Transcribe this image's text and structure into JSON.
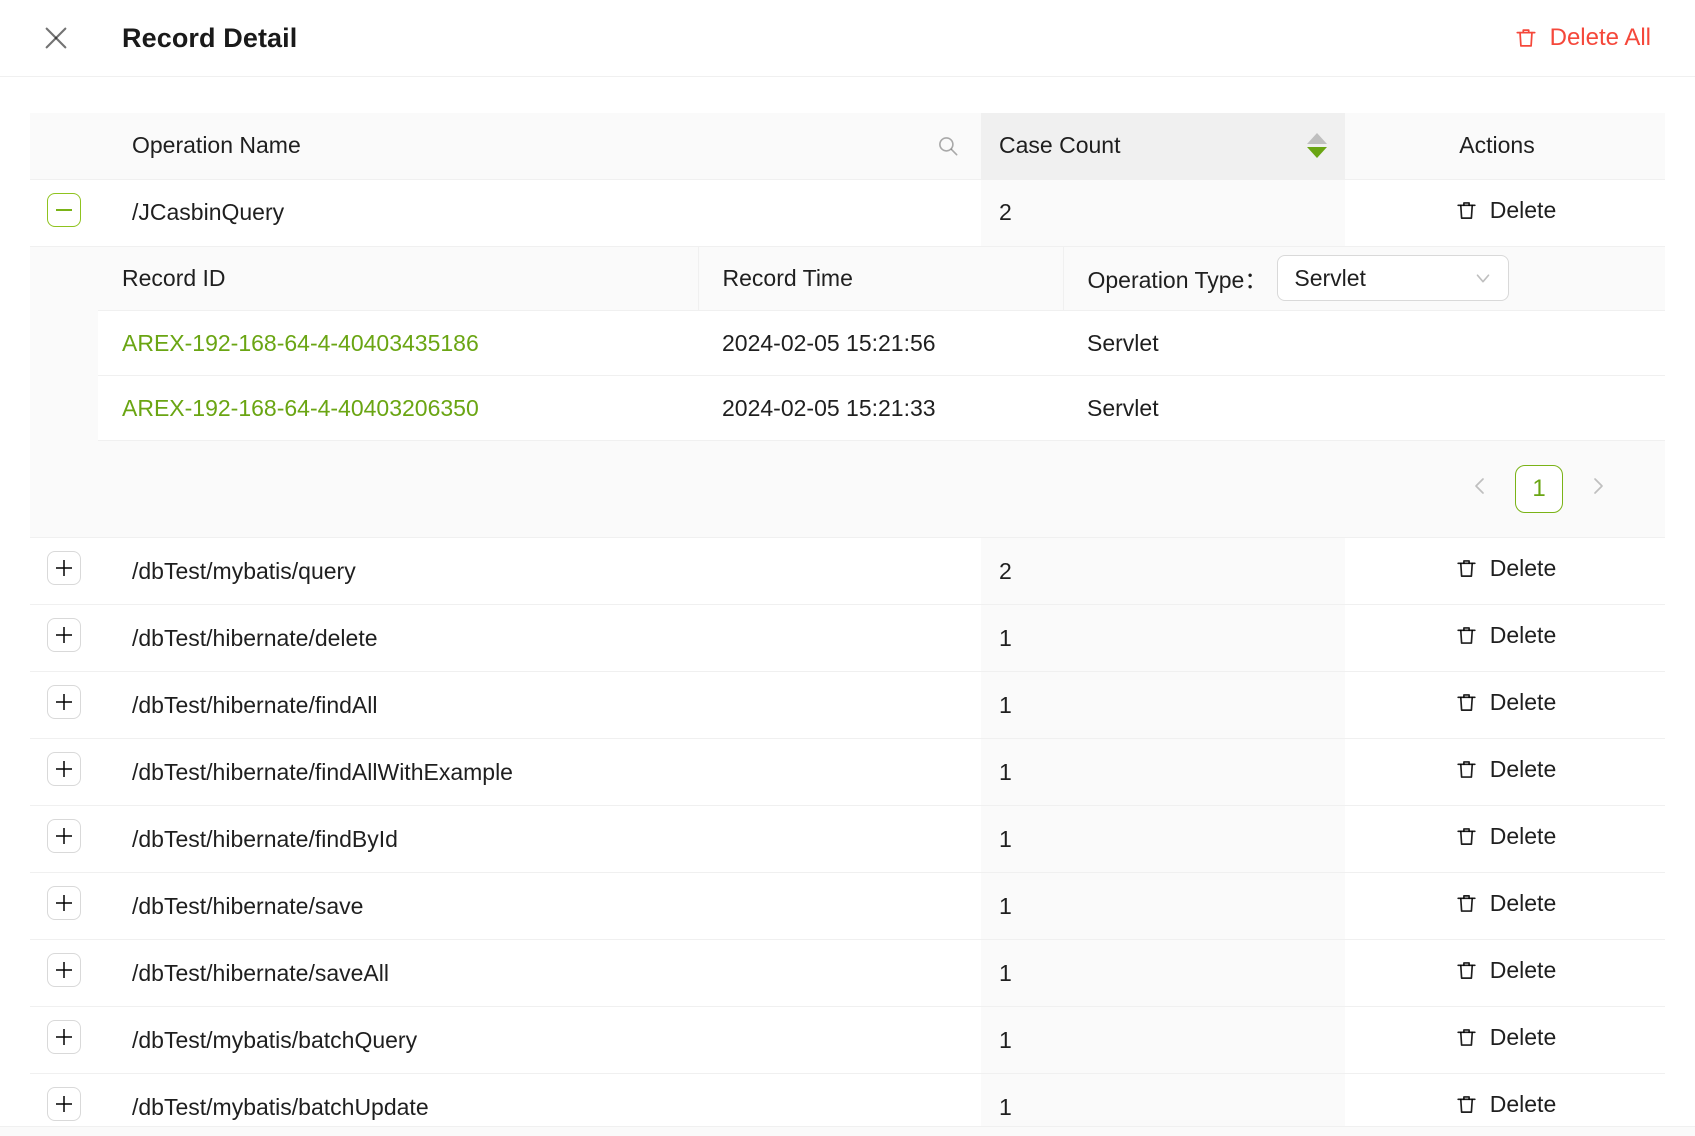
{
  "header": {
    "title": "Record Detail",
    "close_icon": "close-icon",
    "delete_all_label": "Delete All",
    "delete_all_icon": "trash-icon",
    "delete_all_color": "#f5483b"
  },
  "table": {
    "columns": {
      "operation_name": "Operation Name",
      "case_count": "Case Count",
      "actions": "Actions"
    },
    "search_icon": "search-icon",
    "sorter": {
      "icon": "sort-caret-icon",
      "ascending_color": "#bfbfbf",
      "descending_color": "#6aa513",
      "active": "descending"
    },
    "row_action_label": "Delete",
    "row_action_icon": "trash-icon",
    "expand_icon_collapsed": "plus-square-icon",
    "expand_icon_expanded": "minus-square-icon",
    "rows": [
      {
        "expanded": true,
        "operation_name": "/JCasbinQuery",
        "case_count": "2",
        "action": "Delete"
      },
      {
        "expanded": false,
        "operation_name": "/dbTest/mybatis/query",
        "case_count": "2",
        "action": "Delete"
      },
      {
        "expanded": false,
        "operation_name": "/dbTest/hibernate/delete",
        "case_count": "1",
        "action": "Delete"
      },
      {
        "expanded": false,
        "operation_name": "/dbTest/hibernate/findAll",
        "case_count": "1",
        "action": "Delete"
      },
      {
        "expanded": false,
        "operation_name": "/dbTest/hibernate/findAllWithExample",
        "case_count": "1",
        "action": "Delete"
      },
      {
        "expanded": false,
        "operation_name": "/dbTest/hibernate/findById",
        "case_count": "1",
        "action": "Delete"
      },
      {
        "expanded": false,
        "operation_name": "/dbTest/hibernate/save",
        "case_count": "1",
        "action": "Delete"
      },
      {
        "expanded": false,
        "operation_name": "/dbTest/hibernate/saveAll",
        "case_count": "1",
        "action": "Delete"
      },
      {
        "expanded": false,
        "operation_name": "/dbTest/mybatis/batchQuery",
        "case_count": "1",
        "action": "Delete"
      },
      {
        "expanded": false,
        "operation_name": "/dbTest/mybatis/batchUpdate",
        "case_count": "1",
        "action": "Delete"
      }
    ]
  },
  "sub_table": {
    "columns": {
      "record_id": "Record ID",
      "record_time": "Record Time",
      "operation_type_label": "Operation Type："
    },
    "operation_type_filter": {
      "value": "Servlet",
      "chevron_icon": "chevron-down-icon"
    },
    "rows": [
      {
        "record_id": "AREX-192-168-64-4-40403435186",
        "record_time": "2024-02-05 15:21:56",
        "operation_type": "Servlet"
      },
      {
        "record_id": "AREX-192-168-64-4-40403206350",
        "record_time": "2024-02-05 15:21:33",
        "operation_type": "Servlet"
      }
    ],
    "record_id_color": "#6aa513",
    "pagination": {
      "prev_icon": "chevron-left-icon",
      "next_icon": "chevron-right-icon",
      "current_page": "1",
      "accent_color": "#7ab317"
    }
  }
}
